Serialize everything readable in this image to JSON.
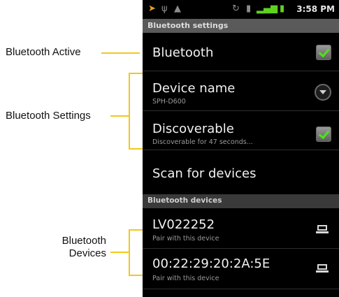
{
  "callouts": {
    "bluetooth_active": "Bluetooth Active",
    "bluetooth_settings": "Bluetooth Settings",
    "bluetooth_devices_line1": "Bluetooth",
    "bluetooth_devices_line2": "Devices"
  },
  "status_bar": {
    "time": "3:58 PM",
    "icons": [
      "play-icon",
      "usb-icon",
      "android-icon",
      "sync-icon",
      "sdcard-icon",
      "signal-icon",
      "battery-icon"
    ]
  },
  "header": {
    "title": "Bluetooth settings"
  },
  "settings": {
    "bluetooth": {
      "label": "Bluetooth",
      "checked": true
    },
    "device_name": {
      "label": "Device name",
      "value": "SPH-D600"
    },
    "discoverable": {
      "label": "Discoverable",
      "summary": "Discoverable for 47 seconds...",
      "checked": true
    },
    "scan": {
      "label": "Scan for devices"
    }
  },
  "devices_section": {
    "title": "Bluetooth devices"
  },
  "devices": [
    {
      "name": "LV022252",
      "summary": "Pair with this device",
      "icon": "laptop-icon"
    },
    {
      "name": "00:22:29:20:2A:5E",
      "summary": "Pair with this device",
      "icon": "laptop-icon"
    }
  ],
  "colors": {
    "callout_line": "#f2c81a",
    "checkmark": "#4fe21a",
    "header_bg": "#5a5a5a"
  }
}
